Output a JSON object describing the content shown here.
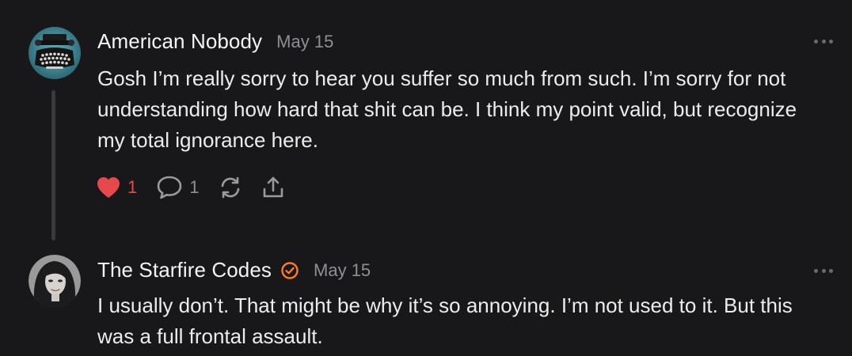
{
  "colors": {
    "background": "#18181b",
    "like": "#e5484d",
    "verified": "#ff7a1a",
    "muted": "#8e8e93"
  },
  "comments": [
    {
      "author": "American Nobody",
      "date": "May 15",
      "avatar_icon": "typewriter-avatar",
      "text": "Gosh I’m really sorry to hear you suffer so much from such. I’m sorry for not understanding how hard that shit can be. I think my point valid, but recognize my total ignorance here.",
      "likes": "1",
      "replies": "1",
      "liked": true
    },
    {
      "author": "The Starfire Codes",
      "verified": true,
      "date": "May 15",
      "avatar_icon": "person-avatar",
      "text": "I usually don’t. That might be why it’s so annoying. I’m not used to it. But this was a full frontal assault."
    }
  ],
  "icons": {
    "like": "heart-icon",
    "reply": "comment-bubble-icon",
    "restack": "restack-icon",
    "share": "share-icon",
    "more": "more-options-icon",
    "verified": "verified-check-icon"
  }
}
